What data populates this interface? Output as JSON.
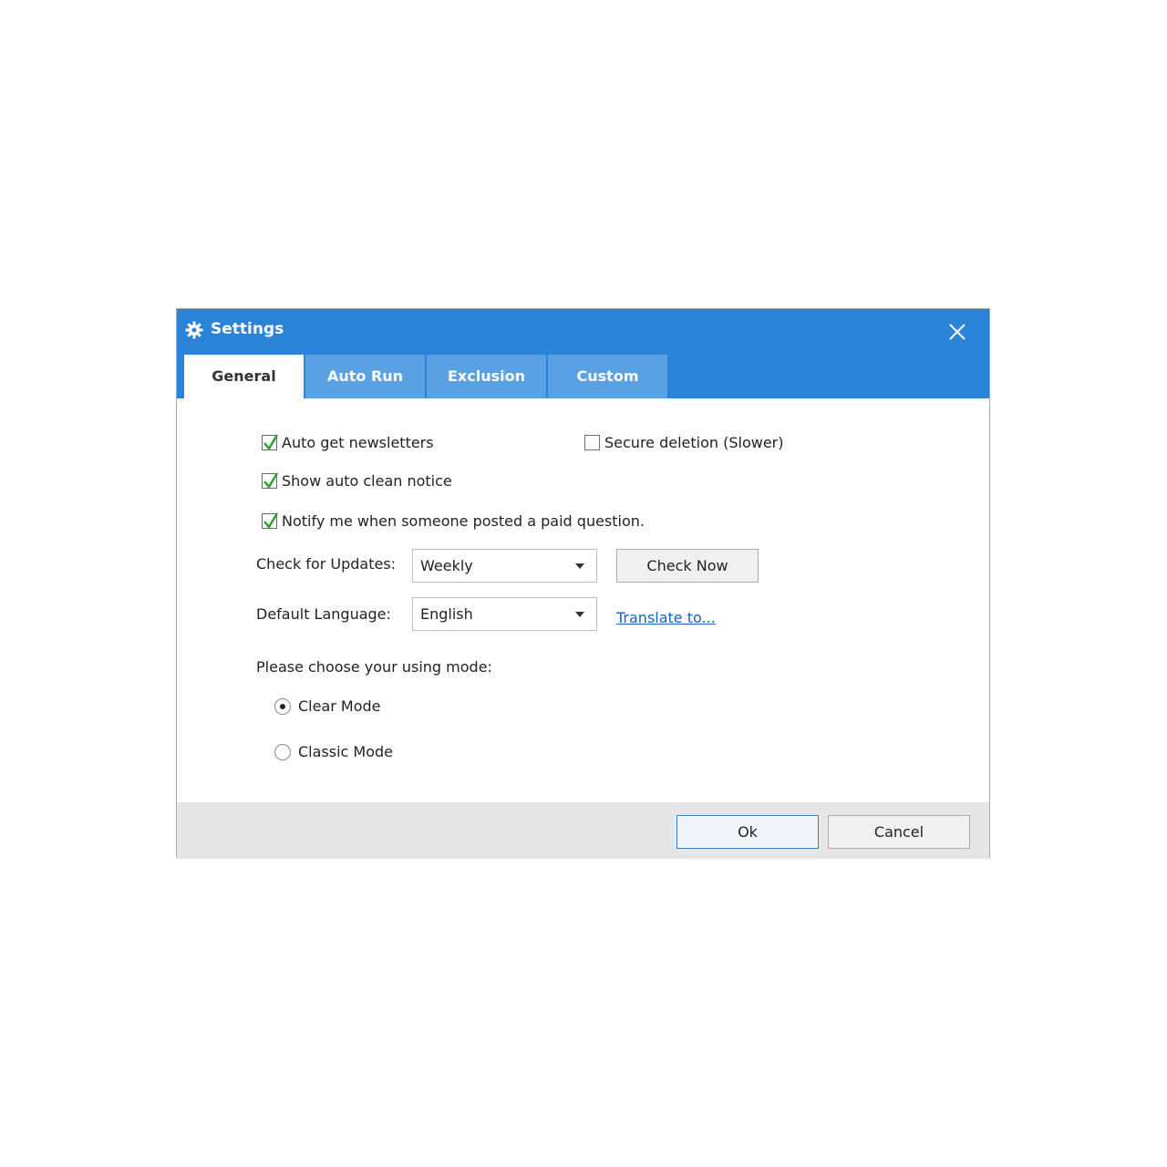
{
  "window": {
    "title": "Settings",
    "icon": "gear-icon"
  },
  "tabs": [
    {
      "label": "General",
      "active": true
    },
    {
      "label": "Auto Run",
      "active": false
    },
    {
      "label": "Exclusion",
      "active": false
    },
    {
      "label": "Custom",
      "active": false
    }
  ],
  "options": {
    "auto_newsletters": {
      "label": "Auto get newsletters",
      "checked": true
    },
    "secure_deletion": {
      "label": "Secure deletion (Slower)",
      "checked": false
    },
    "show_auto_clean": {
      "label": "Show auto clean notice",
      "checked": true
    },
    "notify_paid_question": {
      "label": "Notify me when someone posted a paid question.",
      "checked": true
    }
  },
  "updates": {
    "label": "Check for Updates:",
    "selected": "Weekly",
    "check_now_label": "Check Now"
  },
  "language": {
    "label": "Default Language:",
    "selected": "English",
    "translate_link": "Translate to..."
  },
  "mode": {
    "prompt": "Please choose your using mode:",
    "options": [
      {
        "label": "Clear Mode",
        "selected": true
      },
      {
        "label": "Classic Mode",
        "selected": false
      }
    ]
  },
  "footer": {
    "ok_label": "Ok",
    "cancel_label": "Cancel"
  },
  "colors": {
    "titlebar": "#2b83d7",
    "tab_inactive": "#5aa1e3",
    "check_green": "#2aa02a",
    "link": "#1c5fc5",
    "footer_bg": "#e6e6e6"
  }
}
